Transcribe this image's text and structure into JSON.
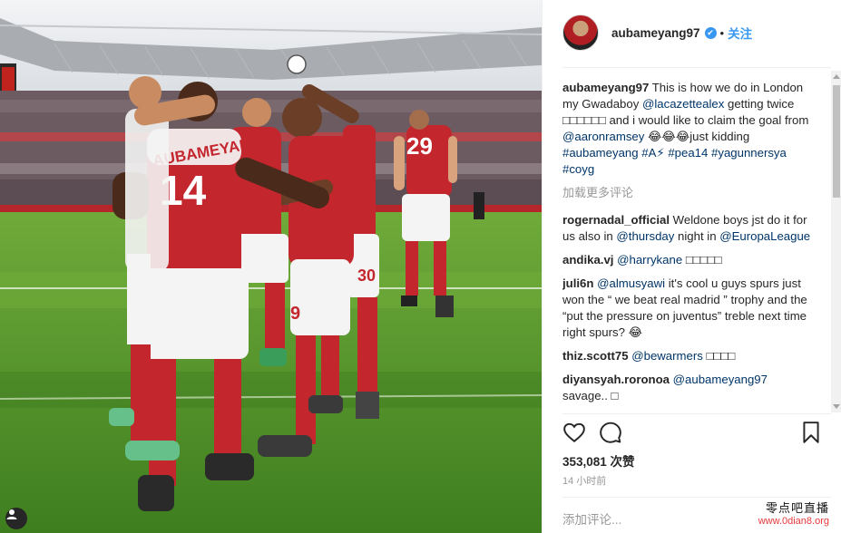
{
  "post": {
    "username": "aubameyang97",
    "verified_mark": "✔",
    "dot": "•",
    "follow_label": "关注",
    "caption_user": "aubameyang97",
    "caption_parts": [
      {
        "t": "This is how we do in London my Gwadaboy "
      },
      {
        "t": "@lacazettealex",
        "link": true
      },
      {
        "t": " getting twice □□□□□□ and i would like to claim the goal from "
      },
      {
        "t": "@aaronramsey",
        "link": true
      },
      {
        "t": " 😂😂😂just kidding "
      },
      {
        "t": "#aubameyang",
        "link": true
      },
      {
        "t": " "
      },
      {
        "t": "#A⚡",
        "link": true
      },
      {
        "t": " "
      },
      {
        "t": "#pea14",
        "link": true
      },
      {
        "t": " "
      },
      {
        "t": "#yagunnersya",
        "link": true
      },
      {
        "t": " "
      },
      {
        "t": "#coyg",
        "link": true
      }
    ],
    "load_more": "加载更多评论",
    "comments": [
      {
        "user": "rogernadal_official",
        "parts": [
          {
            "t": "Weldone boys jst do it for us also in "
          },
          {
            "t": "@thursday",
            "link": true
          },
          {
            "t": " night in "
          },
          {
            "t": "@EuropaLeague",
            "link": true
          }
        ]
      },
      {
        "user": "andika.vj",
        "parts": [
          {
            "t": "@harrykane",
            "link": true
          },
          {
            "t": " □□□□□"
          }
        ]
      },
      {
        "user": "juli6n",
        "parts": [
          {
            "t": "@almusyawi",
            "link": true
          },
          {
            "t": " it's cool u guys spurs just won the “ we beat real madrid ” trophy and the “put the pressure on juventus” treble next time right spurs? 😂"
          }
        ]
      },
      {
        "user": "thiz.scott75",
        "parts": [
          {
            "t": "@bewarmers",
            "link": true
          },
          {
            "t": " □□□□"
          }
        ]
      },
      {
        "user": "diyansyah.roronoa",
        "parts": [
          {
            "t": "@aubameyang97",
            "link": true
          },
          {
            "t": " savage.. □"
          }
        ]
      }
    ],
    "likes_text": "353,081 次赞",
    "time_ago": "14 小时前",
    "add_comment_placeholder": "添加评论...",
    "watermark_name": "零点吧直播",
    "watermark_url": "www.0dian8.org",
    "accent_color": "#3897f0",
    "link_color": "#003569",
    "icons": {
      "like": "heart-icon",
      "comment": "speech-bubble-icon",
      "save": "bookmark-icon",
      "photo_tag": "user-tag-icon"
    }
  }
}
